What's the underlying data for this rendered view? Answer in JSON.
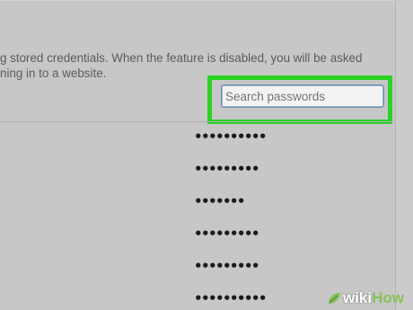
{
  "description": {
    "line1": "g stored credentials. When the feature is disabled, you will be asked",
    "line2": "ning in to a website."
  },
  "search": {
    "placeholder": "Search passwords"
  },
  "password_rows": [
    "••••••••••",
    "•••••••••",
    "•••••••",
    "•••••••••",
    "•••••••••",
    "••••••••••"
  ],
  "watermark": {
    "part1": "wiki",
    "part2": "How"
  },
  "colors": {
    "highlight": "#2bd324",
    "background": "#c7c7c7",
    "watermark_accent": "#86c25a"
  }
}
